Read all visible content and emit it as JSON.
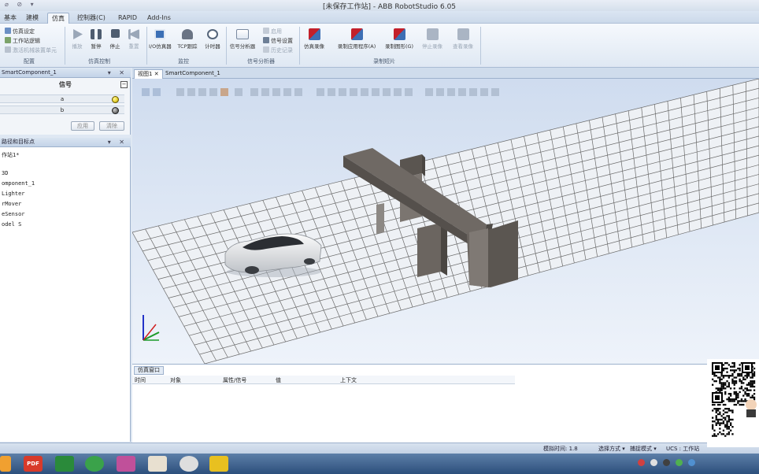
{
  "window": {
    "title": "[未保存工作站] - ABB RobotStudio 6.05",
    "quick_access": "⌀ ⊘ ▾"
  },
  "ribbon_tabs": [
    {
      "label": "基本",
      "active": false
    },
    {
      "label": "建模",
      "active": false
    },
    {
      "label": "仿真",
      "active": true
    },
    {
      "label": "控制器(C)",
      "active": false
    },
    {
      "label": "RAPID",
      "active": false
    },
    {
      "label": "Add-Ins",
      "active": false
    }
  ],
  "ribbon": {
    "config": {
      "items": [
        "仿真设定",
        "工作站逻辑",
        "激活机械装置单元"
      ],
      "label": "配置"
    },
    "sim_control": {
      "buttons": [
        "播放",
        "暂停",
        "停止",
        "重置"
      ],
      "label": "仿真控制"
    },
    "monitor": {
      "buttons": [
        "I/O仿真器",
        "TCP跟踪",
        "计时器"
      ],
      "label": "监控"
    },
    "signal_analyzer": {
      "button": "信号分析器",
      "items": [
        "启用",
        "信号设置",
        "历史记录"
      ],
      "label": "信号分析器"
    },
    "recording": {
      "buttons": [
        "仿真录像",
        "录制应用程序(A)",
        "录制图形(G)",
        "停止录像",
        "查看录像"
      ],
      "label": "录制短片"
    }
  },
  "signal_pane": {
    "title": "SmartComponent_1",
    "header": "信号",
    "rows": [
      {
        "label": "a",
        "state": "on",
        "color": "#e8d430"
      },
      {
        "label": "b",
        "state": "off",
        "color": "#7a7a7a"
      }
    ],
    "apply_label": "应用",
    "clear_label": "清除"
  },
  "tree_pane": {
    "title": "路径和目标点",
    "items": [
      "作站1*",
      "",
      "3D",
      "omponent_1",
      "Lighter",
      "rMover",
      "eSensor",
      "odel S"
    ]
  },
  "doc_tabs": [
    {
      "label": "视图1",
      "active": true
    },
    {
      "label": "SmartComponent_1",
      "active": false
    }
  ],
  "output_pane": {
    "tab": "仿真窗口",
    "columns": [
      "时间",
      "对象",
      "属性/信号",
      "值",
      "上下文"
    ]
  },
  "status": {
    "sim_time": "模拟时间: 1.8",
    "select_mode": "选择方式",
    "snap_mode": "捕捉模式",
    "ucs": "UCS : 工作站"
  },
  "taskbar": {
    "apps": [
      "windows-icon",
      "pdf-icon",
      "excel-icon",
      "browser-icon",
      "robotstudio-icon",
      "video-icon",
      "recorder-icon",
      "notes-icon"
    ],
    "pdf_label": "PDF"
  },
  "colors": {
    "signal_on": "#e8d430",
    "gate_dark": "#6b6560",
    "grid_line": "#6a6a6a",
    "viewport_bg": "#dce7f5"
  }
}
